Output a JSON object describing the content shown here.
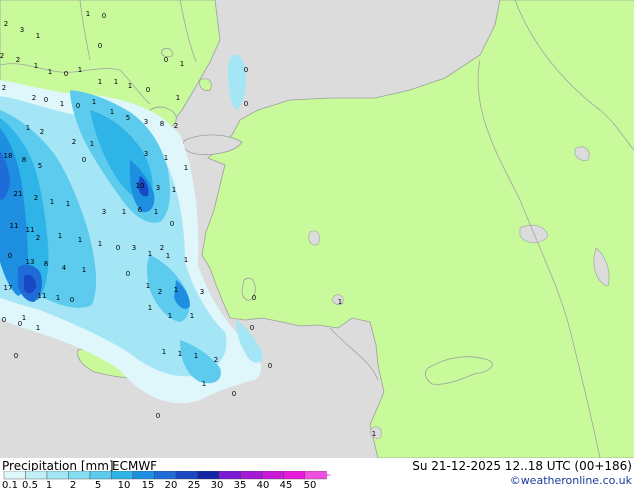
{
  "header": {
    "title": "Precipitation [mm]",
    "model": "ECMWF",
    "valid": "Su 21-12-2025 12..18 UTC (00+186)",
    "credit": "©weatheronline.co.uk"
  },
  "colors": {
    "sea": "#dcdcdc",
    "land": "#c8fa9b",
    "border": "#a3a3a3"
  },
  "legend": {
    "ticks": [
      "0.1",
      "0.5",
      "1",
      "2",
      "5",
      "10",
      "15",
      "20",
      "25",
      "30",
      "35",
      "40",
      "45",
      "50"
    ],
    "colors": [
      "#dff6fb",
      "#c2eef8",
      "#a4e6f5",
      "#86def2",
      "#5ccbee",
      "#2fb4e8",
      "#1e8fe0",
      "#1f6cd8",
      "#1848c4",
      "#1226a6",
      "#7a1ad2",
      "#a41ad6",
      "#c81ad8",
      "#e81ad8",
      "#f050e0"
    ]
  },
  "map_labels": [
    "2",
    "3",
    "1",
    "1",
    "0",
    "2",
    "2",
    "1",
    "0",
    "1",
    "0",
    "1",
    "1",
    "2",
    "0",
    "0",
    "1",
    "1",
    "1",
    "0",
    "2",
    "1",
    "1",
    "0",
    "1",
    "5",
    "3",
    "8",
    "1",
    "2",
    "1",
    "1",
    "1",
    "2",
    "18",
    "5",
    "8",
    "2",
    "1",
    "3",
    "10",
    "3",
    "1",
    "21",
    "2",
    "1",
    "1",
    "11",
    "3",
    "1",
    "6",
    "1",
    "0",
    "2",
    "1",
    "1",
    "11",
    "13",
    "1",
    "0",
    "3",
    "1",
    "0",
    "8",
    "4",
    "1",
    "1",
    "1",
    "0",
    "17",
    "11",
    "1",
    "0",
    "1",
    "2",
    "1",
    "0",
    "1",
    "0",
    "1",
    "1",
    "1",
    "1",
    "1",
    "1",
    "1",
    "2",
    "1",
    "0",
    "0",
    "0",
    "0",
    "0",
    "0",
    "0",
    "0",
    "3",
    "2",
    "1",
    "1",
    "0"
  ]
}
